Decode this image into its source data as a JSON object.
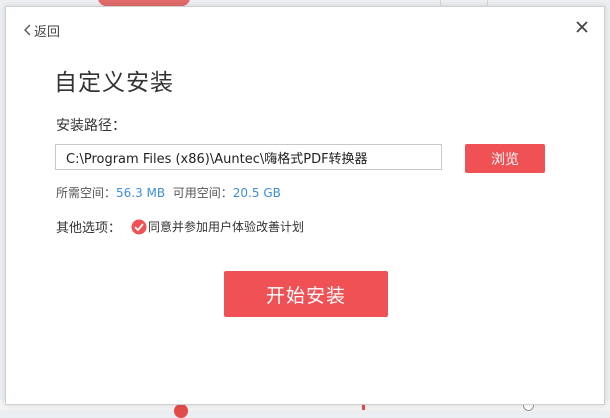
{
  "dialog": {
    "back_label": "返回",
    "title": "自定义安装",
    "path_label": "安装路径：",
    "path_value": "C:\\Program Files (x86)\\Auntec\\嗨格式PDF转换器",
    "browse_label": "浏览",
    "required_space_label": "所需空间：",
    "required_space_value": "56.3 MB",
    "available_space_label": "可用空间：",
    "available_space_value": "20.5 GB",
    "options_label": "其他选项：",
    "agree_label": "同意并参加用户体验改善计划",
    "agree_checked": true,
    "install_label": "开始安装"
  },
  "colors": {
    "accent": "#f05155",
    "link_value": "#3e8fd8"
  }
}
